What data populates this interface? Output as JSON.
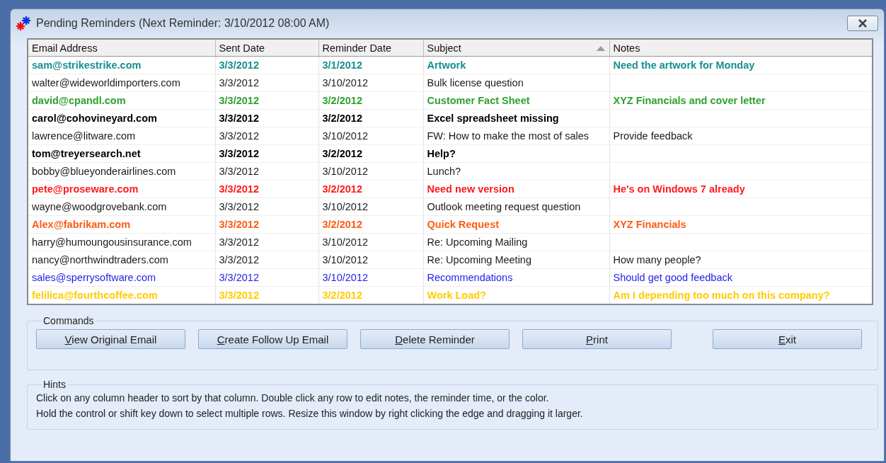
{
  "window": {
    "title": "Pending Reminders (Next Reminder: 3/10/2012 08:00 AM)"
  },
  "table": {
    "columns": [
      {
        "label": "Email Address",
        "sorted": false
      },
      {
        "label": "Sent Date",
        "sorted": false
      },
      {
        "label": "Reminder Date",
        "sorted": false
      },
      {
        "label": "Subject",
        "sorted": true
      },
      {
        "label": "Notes",
        "sorted": false
      }
    ],
    "rows": [
      {
        "cells": [
          "sam@strikestrike.com",
          "3/3/2012",
          "3/1/2012",
          "Artwork",
          "Need the artwork for Monday"
        ],
        "color": "#168f8f",
        "bold": true
      },
      {
        "cells": [
          "walter@wideworldimporters.com",
          "3/3/2012",
          "3/10/2012",
          "Bulk license question",
          ""
        ],
        "color": "#1a1a1a",
        "bold": false
      },
      {
        "cells": [
          "david@cpandl.com",
          "3/3/2012",
          "3/2/2012",
          "Customer Fact Sheet",
          "XYZ Financials and cover letter"
        ],
        "color": "#2fa12f",
        "bold": true
      },
      {
        "cells": [
          "carol@cohovineyard.com",
          "3/3/2012",
          "3/2/2012",
          "Excel spreadsheet missing",
          ""
        ],
        "color": "#000000",
        "bold": true
      },
      {
        "cells": [
          "lawrence@litware.com",
          "3/3/2012",
          "3/10/2012",
          "FW: How to make the most of sales",
          "Provide feedback"
        ],
        "color": "#1a1a1a",
        "bold": false
      },
      {
        "cells": [
          "tom@treyersearch.net",
          "3/3/2012",
          "3/2/2012",
          "Help?",
          ""
        ],
        "color": "#000000",
        "bold": true
      },
      {
        "cells": [
          "bobby@blueyonderairlines.com",
          "3/3/2012",
          "3/10/2012",
          "Lunch?",
          ""
        ],
        "color": "#1a1a1a",
        "bold": false
      },
      {
        "cells": [
          "pete@proseware.com",
          "3/3/2012",
          "3/2/2012",
          "Need new version",
          "He's on Windows 7 already"
        ],
        "color": "#ff1a1a",
        "bold": true
      },
      {
        "cells": [
          "wayne@woodgrovebank.com",
          "3/3/2012",
          "3/10/2012",
          "Outlook meeting request question",
          ""
        ],
        "color": "#1a1a1a",
        "bold": false
      },
      {
        "cells": [
          "Alex@fabrikam.com",
          "3/3/2012",
          "3/2/2012",
          "Quick Request",
          "XYZ Financials"
        ],
        "color": "#ff5a14",
        "bold": true
      },
      {
        "cells": [
          "harry@humoungousinsurance.com",
          "3/3/2012",
          "3/10/2012",
          "Re: Upcoming Mailing",
          ""
        ],
        "color": "#1a1a1a",
        "bold": false
      },
      {
        "cells": [
          "nancy@northwindtraders.com",
          "3/3/2012",
          "3/10/2012",
          "Re: Upcoming Meeting",
          "How many people?"
        ],
        "color": "#1a1a1a",
        "bold": false
      },
      {
        "cells": [
          "sales@sperrysoftware.com",
          "3/3/2012",
          "3/10/2012",
          "Recommendations",
          "Should get good feedback"
        ],
        "color": "#1e1ee6",
        "bold": false
      },
      {
        "cells": [
          "felilica@fourthcoffee.com",
          "3/3/2012",
          "3/2/2012",
          "Work Load?",
          "Am I depending too much on this company?"
        ],
        "color": "#ffcc00",
        "bold": true
      }
    ]
  },
  "commands": {
    "title": "Commands",
    "buttons": [
      {
        "label": "View Original Email",
        "underline_first": true
      },
      {
        "label": "Create Follow Up Email",
        "underline_first": true
      },
      {
        "label": "Delete Reminder",
        "underline_first": true
      },
      {
        "label": "Print",
        "underline_first": true
      },
      {
        "label": "Exit",
        "underline_first": true
      }
    ]
  },
  "hints": {
    "title": "Hints",
    "lines": [
      "Click on any column header to sort by that column. Double click any row to edit notes, the reminder time, or the color.",
      "Hold the control or shift key down to select multiple rows. Resize this window by right clicking the edge and dragging it larger."
    ]
  }
}
